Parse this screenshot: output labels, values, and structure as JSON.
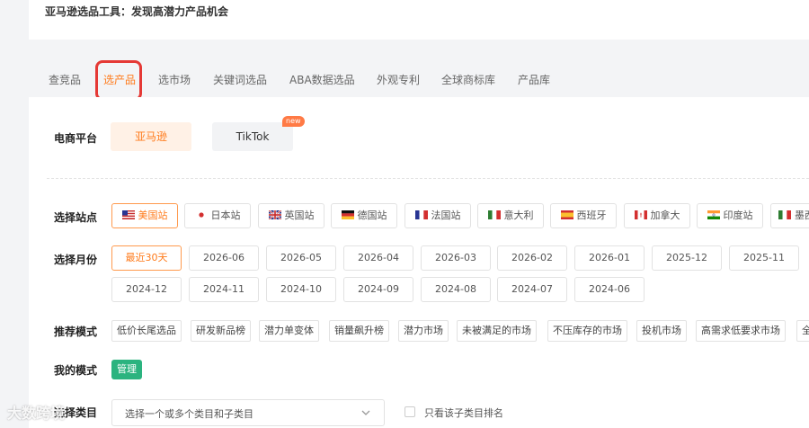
{
  "header": {
    "title": "亚马逊选品工具：发现高潜力产品机会"
  },
  "tabs": [
    {
      "label": "查竞品"
    },
    {
      "label": "选产品",
      "active": true
    },
    {
      "label": "选市场"
    },
    {
      "label": "关键词选品"
    },
    {
      "label": "ABA数据选品"
    },
    {
      "label": "外观专利"
    },
    {
      "label": "全球商标库"
    },
    {
      "label": "产品库"
    }
  ],
  "platform": {
    "label": "电商平台",
    "options": [
      {
        "label": "亚马逊",
        "active": true
      },
      {
        "label": "TikTok",
        "badge": "new"
      }
    ]
  },
  "site": {
    "label": "选择站点",
    "options": [
      {
        "label": "美国站",
        "flag": "us-flag-icon",
        "active": true
      },
      {
        "label": "日本站",
        "flag": "jp-flag-icon"
      },
      {
        "label": "英国站",
        "flag": "uk-flag-icon"
      },
      {
        "label": "德国站",
        "flag": "de-flag-icon"
      },
      {
        "label": "法国站",
        "flag": "fr-flag-icon"
      },
      {
        "label": "意大利",
        "flag": "it-flag-icon"
      },
      {
        "label": "西班牙",
        "flag": "es-flag-icon"
      },
      {
        "label": "加拿大",
        "flag": "ca-flag-icon"
      },
      {
        "label": "印度站",
        "flag": "in-flag-icon"
      },
      {
        "label": "墨西",
        "flag": "mx-flag-icon"
      }
    ]
  },
  "month": {
    "label": "选择月份",
    "row1": [
      "最近30天",
      "2026-06",
      "2026-05",
      "2026-04",
      "2026-03",
      "2026-02",
      "2026-01",
      "2025-12",
      "2025-11"
    ],
    "row2": [
      "2024-12",
      "2024-11",
      "2024-10",
      "2024-09",
      "2024-08",
      "2024-07",
      "2024-06"
    ]
  },
  "mode": {
    "label": "推荐模式",
    "options": [
      "低价长尾选品",
      "研发新品榜",
      "潜力单变体",
      "销量飙升榜",
      "潜力市场",
      "未被满足的市场",
      "不压库存的市场",
      "投机市场",
      "高需求低要求市场",
      "全"
    ]
  },
  "my_mode": {
    "label": "我的模式",
    "manage": "管理"
  },
  "category": {
    "label": "选择类目",
    "placeholder": "选择一个或多个类目和子类目",
    "checkbox_label": "只看该子类目排名"
  },
  "watermark": "大数跨境",
  "colors": {
    "accent": "#ff7a1a",
    "highlight": "#e53935",
    "manage": "#2bb37f"
  }
}
